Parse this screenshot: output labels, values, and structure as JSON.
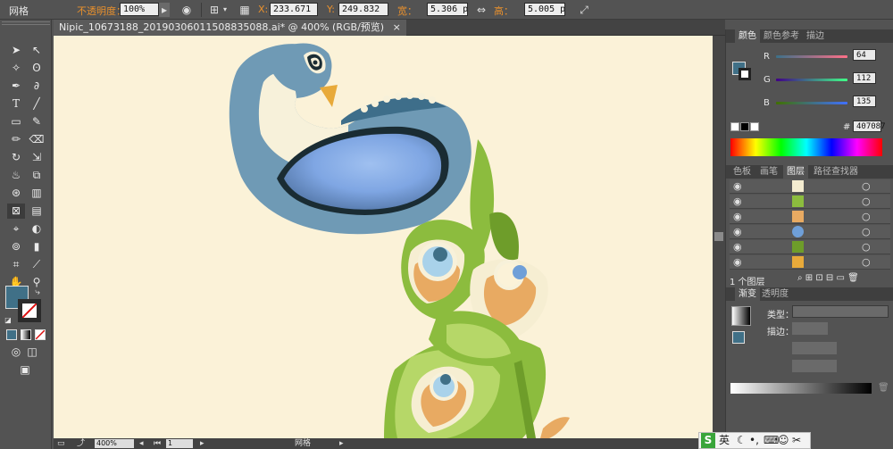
{
  "control_bar": {
    "mode_label": "网格",
    "opacity_label": "不透明度：",
    "opacity_value": "100%",
    "x_label": "X:",
    "x_value": "233.671",
    "y_label": "Y:",
    "y_value": "249.832",
    "width_label": "宽：",
    "width_value": "5.306 px",
    "height_label": "高：",
    "height_value": "5.005 px",
    "labels_color": "#e8902d"
  },
  "document_tab": {
    "title": "Nipic_10673188_20190306011508835088.ai* @ 400% (RGB/预览)",
    "close": "×"
  },
  "status_bar": {
    "zoom": "400%",
    "artboard": "1",
    "tool": "网格"
  },
  "color_panel": {
    "tabs": [
      "颜色",
      "颜色参考",
      "描边"
    ],
    "r_label": "R",
    "r_value": "64",
    "g_label": "G",
    "g_value": "112",
    "b_label": "B",
    "b_value": "135",
    "hex_label": "#",
    "hex_value": "407087",
    "fill_color": "#407087"
  },
  "layers_panel": {
    "tabs": [
      "色板",
      "画笔",
      "图层",
      "路径查找器"
    ],
    "footer": "1 个图层",
    "rows": 7
  },
  "gradient_panel": {
    "tabs": [
      "渐变",
      "透明度"
    ],
    "type_label": "类型：",
    "stroke_label": "描边："
  },
  "taskbar": {
    "ime": "英"
  }
}
